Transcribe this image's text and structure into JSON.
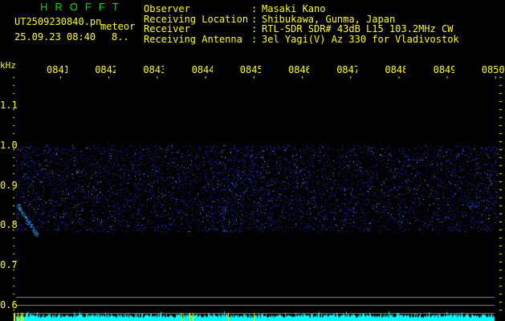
{
  "header": {
    "title": "HROFFT",
    "filename": "UT2509230840.pn",
    "mode": "meteor",
    "datetime": "25.09.23 08:40",
    "count": "8..",
    "info": [
      {
        "label": "Observer",
        "value": "Masaki Kano"
      },
      {
        "label": "Receiving Location",
        "value": "Shibukawa, Gunma, Japan"
      },
      {
        "label": "Receiver",
        "value": "RTL-SDR SDR# 43dB L15 103.2MHz CW"
      },
      {
        "label": "Receiving Antenna",
        "value": "3el Yagi(V) Az 330 for Vladivostok"
      }
    ]
  },
  "axis": {
    "y_unit": "kHz",
    "y_ticks": [
      "1.1",
      "1.0",
      "0.9",
      "0.8",
      "0.7",
      "0.6"
    ],
    "x_ticks": [
      "0841",
      "0842",
      "0843",
      "0844",
      "0845",
      "0846",
      "0847",
      "0848",
      "0849",
      "0850"
    ]
  },
  "colors": {
    "text": "#ffff00",
    "title": "#00e000",
    "signal": "#3060ff",
    "histogram": "#00ffff"
  }
}
